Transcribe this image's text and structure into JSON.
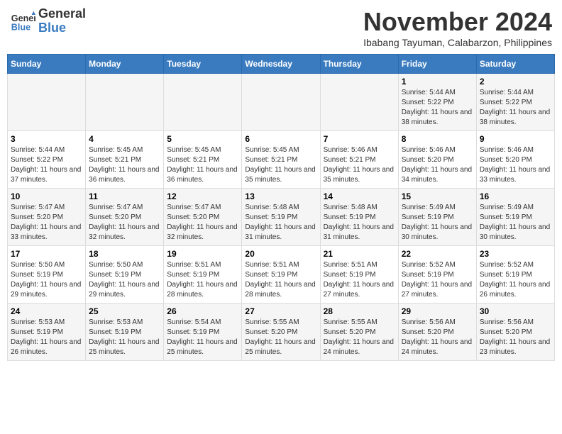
{
  "header": {
    "logo_line1": "General",
    "logo_line2": "Blue",
    "month": "November 2024",
    "location": "Ibabang Tayuman, Calabarzon, Philippines"
  },
  "weekdays": [
    "Sunday",
    "Monday",
    "Tuesday",
    "Wednesday",
    "Thursday",
    "Friday",
    "Saturday"
  ],
  "weeks": [
    [
      {
        "day": "",
        "info": ""
      },
      {
        "day": "",
        "info": ""
      },
      {
        "day": "",
        "info": ""
      },
      {
        "day": "",
        "info": ""
      },
      {
        "day": "",
        "info": ""
      },
      {
        "day": "1",
        "info": "Sunrise: 5:44 AM\nSunset: 5:22 PM\nDaylight: 11 hours and 38 minutes."
      },
      {
        "day": "2",
        "info": "Sunrise: 5:44 AM\nSunset: 5:22 PM\nDaylight: 11 hours and 38 minutes."
      }
    ],
    [
      {
        "day": "3",
        "info": "Sunrise: 5:44 AM\nSunset: 5:22 PM\nDaylight: 11 hours and 37 minutes."
      },
      {
        "day": "4",
        "info": "Sunrise: 5:45 AM\nSunset: 5:21 PM\nDaylight: 11 hours and 36 minutes."
      },
      {
        "day": "5",
        "info": "Sunrise: 5:45 AM\nSunset: 5:21 PM\nDaylight: 11 hours and 36 minutes."
      },
      {
        "day": "6",
        "info": "Sunrise: 5:45 AM\nSunset: 5:21 PM\nDaylight: 11 hours and 35 minutes."
      },
      {
        "day": "7",
        "info": "Sunrise: 5:46 AM\nSunset: 5:21 PM\nDaylight: 11 hours and 35 minutes."
      },
      {
        "day": "8",
        "info": "Sunrise: 5:46 AM\nSunset: 5:20 PM\nDaylight: 11 hours and 34 minutes."
      },
      {
        "day": "9",
        "info": "Sunrise: 5:46 AM\nSunset: 5:20 PM\nDaylight: 11 hours and 33 minutes."
      }
    ],
    [
      {
        "day": "10",
        "info": "Sunrise: 5:47 AM\nSunset: 5:20 PM\nDaylight: 11 hours and 33 minutes."
      },
      {
        "day": "11",
        "info": "Sunrise: 5:47 AM\nSunset: 5:20 PM\nDaylight: 11 hours and 32 minutes."
      },
      {
        "day": "12",
        "info": "Sunrise: 5:47 AM\nSunset: 5:20 PM\nDaylight: 11 hours and 32 minutes."
      },
      {
        "day": "13",
        "info": "Sunrise: 5:48 AM\nSunset: 5:19 PM\nDaylight: 11 hours and 31 minutes."
      },
      {
        "day": "14",
        "info": "Sunrise: 5:48 AM\nSunset: 5:19 PM\nDaylight: 11 hours and 31 minutes."
      },
      {
        "day": "15",
        "info": "Sunrise: 5:49 AM\nSunset: 5:19 PM\nDaylight: 11 hours and 30 minutes."
      },
      {
        "day": "16",
        "info": "Sunrise: 5:49 AM\nSunset: 5:19 PM\nDaylight: 11 hours and 30 minutes."
      }
    ],
    [
      {
        "day": "17",
        "info": "Sunrise: 5:50 AM\nSunset: 5:19 PM\nDaylight: 11 hours and 29 minutes."
      },
      {
        "day": "18",
        "info": "Sunrise: 5:50 AM\nSunset: 5:19 PM\nDaylight: 11 hours and 29 minutes."
      },
      {
        "day": "19",
        "info": "Sunrise: 5:51 AM\nSunset: 5:19 PM\nDaylight: 11 hours and 28 minutes."
      },
      {
        "day": "20",
        "info": "Sunrise: 5:51 AM\nSunset: 5:19 PM\nDaylight: 11 hours and 28 minutes."
      },
      {
        "day": "21",
        "info": "Sunrise: 5:51 AM\nSunset: 5:19 PM\nDaylight: 11 hours and 27 minutes."
      },
      {
        "day": "22",
        "info": "Sunrise: 5:52 AM\nSunset: 5:19 PM\nDaylight: 11 hours and 27 minutes."
      },
      {
        "day": "23",
        "info": "Sunrise: 5:52 AM\nSunset: 5:19 PM\nDaylight: 11 hours and 26 minutes."
      }
    ],
    [
      {
        "day": "24",
        "info": "Sunrise: 5:53 AM\nSunset: 5:19 PM\nDaylight: 11 hours and 26 minutes."
      },
      {
        "day": "25",
        "info": "Sunrise: 5:53 AM\nSunset: 5:19 PM\nDaylight: 11 hours and 25 minutes."
      },
      {
        "day": "26",
        "info": "Sunrise: 5:54 AM\nSunset: 5:19 PM\nDaylight: 11 hours and 25 minutes."
      },
      {
        "day": "27",
        "info": "Sunrise: 5:55 AM\nSunset: 5:20 PM\nDaylight: 11 hours and 25 minutes."
      },
      {
        "day": "28",
        "info": "Sunrise: 5:55 AM\nSunset: 5:20 PM\nDaylight: 11 hours and 24 minutes."
      },
      {
        "day": "29",
        "info": "Sunrise: 5:56 AM\nSunset: 5:20 PM\nDaylight: 11 hours and 24 minutes."
      },
      {
        "day": "30",
        "info": "Sunrise: 5:56 AM\nSunset: 5:20 PM\nDaylight: 11 hours and 23 minutes."
      }
    ]
  ]
}
